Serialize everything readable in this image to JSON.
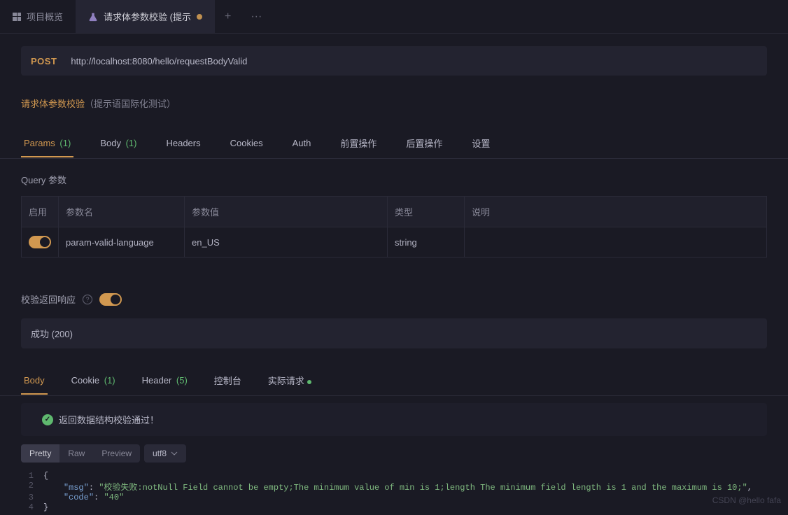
{
  "topTabs": {
    "overview": "项目概览",
    "active": "请求体参数校验 (提示"
  },
  "request": {
    "method": "POST",
    "url": "http://localhost:8080/hello/requestBodyValid"
  },
  "apiTitle": "请求体参数校验",
  "apiSubtitle": "（提示语国际化测试）",
  "reqTabs": {
    "params": "Params",
    "paramsCount": "(1)",
    "body": "Body",
    "bodyCount": "(1)",
    "headers": "Headers",
    "cookies": "Cookies",
    "auth": "Auth",
    "preOp": "前置操作",
    "postOp": "后置操作",
    "settings": "设置"
  },
  "query": {
    "title": "Query 参数",
    "headers": {
      "enable": "启用",
      "name": "参数名",
      "value": "参数值",
      "type": "类型",
      "desc": "说明"
    },
    "rows": [
      {
        "name": "param-valid-language",
        "value": "en_US",
        "type": "string",
        "desc": ""
      }
    ]
  },
  "respValidate": {
    "label": "校验返回响应"
  },
  "statusSelect": "成功 (200)",
  "respTabs": {
    "body": "Body",
    "cookie": "Cookie",
    "cookieCount": "(1)",
    "header": "Header",
    "headerCount": "(5)",
    "console": "控制台",
    "actual": "实际请求"
  },
  "validation": {
    "msg": "返回数据结构校验通过！"
  },
  "bodyToolbar": {
    "pretty": "Pretty",
    "raw": "Raw",
    "preview": "Preview",
    "encoding": "utf8"
  },
  "responseJson": {
    "msg": "校验失败:notNull Field cannot be empty;The minimum value of min is 1;length The minimum field length is 1 and the maximum is 10;",
    "code": "40"
  },
  "watermark": "CSDN @hello fafa"
}
